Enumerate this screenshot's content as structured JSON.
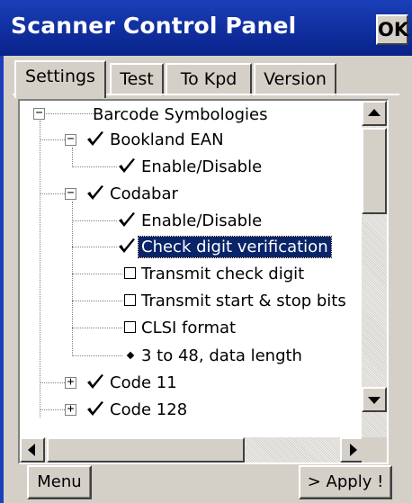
{
  "window": {
    "title": "Scanner Control Panel",
    "ok_label": "OK"
  },
  "tabs": [
    {
      "label": "Settings",
      "active": true
    },
    {
      "label": "Test",
      "active": false
    },
    {
      "label": "To Kpd",
      "active": false
    },
    {
      "label": "Version",
      "active": false
    }
  ],
  "tree": {
    "root": {
      "label": "Barcode Symbologies",
      "expander": "−"
    },
    "items": [
      {
        "label": "Bookland EAN",
        "state": "checked",
        "expander": "−"
      },
      {
        "label": "Enable/Disable",
        "state": "checked"
      },
      {
        "label": "Codabar",
        "state": "checked",
        "expander": "−"
      },
      {
        "label": "Enable/Disable",
        "state": "checked"
      },
      {
        "label": "Check digit verification",
        "state": "checked",
        "selected": true
      },
      {
        "label": "Transmit check digit",
        "state": "unchecked"
      },
      {
        "label": "Transmit start & stop bits",
        "state": "unchecked"
      },
      {
        "label": "CLSI format",
        "state": "unchecked"
      },
      {
        "label": "3 to 48, data length",
        "state": "value"
      },
      {
        "label": "Code 11",
        "state": "checked",
        "expander": "+"
      },
      {
        "label": "Code 128",
        "state": "checked",
        "expander": "+"
      }
    ]
  },
  "buttons": {
    "menu_label": "Menu",
    "apply_label": "> Apply !"
  },
  "icons": {
    "ok": "ok-button",
    "check": "checkmark-icon",
    "unchecked": "empty-checkbox-icon",
    "value": "diamond-bullet-icon",
    "scroll_up": "triangle-up-icon",
    "scroll_down": "triangle-down-icon",
    "scroll_left": "triangle-left-icon",
    "scroll_right": "triangle-right-icon"
  },
  "colors": {
    "titlebar": "#0a2a9a",
    "selection": "#0a246a",
    "face": "#d4d0c8"
  }
}
